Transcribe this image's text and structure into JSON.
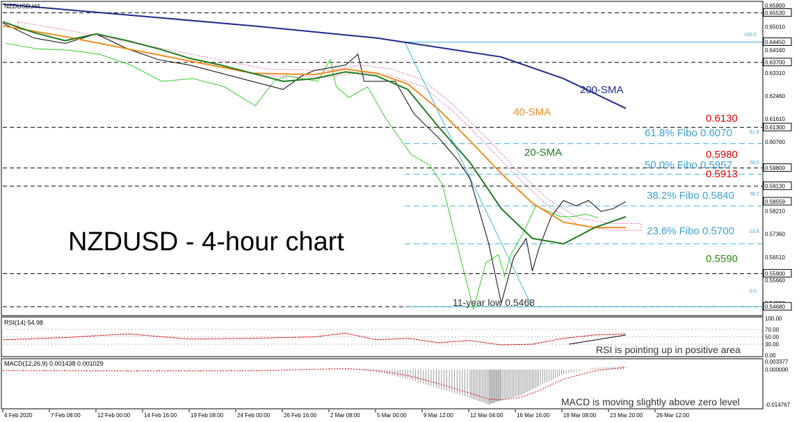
{
  "header": {
    "symbol": "NZDUSD,H4",
    "rsi_title": "RSI(14) 54.98",
    "macd_title": "MACD(12,26,9) 0.001438 0.001029"
  },
  "main_annotation": "NZDUSD - 4-hour chart",
  "chart_data": [
    {
      "type": "line",
      "title": "NZDUSD - 4-hour chart",
      "x_ticks": [
        "4 Feb 2020",
        "7 Feb 08:00",
        "12 Feb 00:00",
        "14 Feb 16:00",
        "19 Feb 08:00",
        "24 Feb 00:00",
        "26 Feb 16:00",
        "2 Mar 08:00",
        "5 Mar 00:00",
        "9 Mar 12:00",
        "12 Mar 04:00",
        "16 Mar 16:00",
        "19 Mar 08:00",
        "23 Mar 20:00",
        "26 Mar 12:00"
      ],
      "ylim": [
        0.544,
        0.659
      ],
      "y_ticks": [
        "0.65800",
        "0.65530",
        "0.65010",
        "0.64450",
        "0.64160",
        "0.63700",
        "0.63310",
        "0.62460",
        "0.61610",
        "0.61300",
        "0.60760",
        "0.59800",
        "0.59130",
        "0.58559",
        "0.58210",
        "0.57360",
        "0.56510",
        "0.55900",
        "0.55660",
        "0.54810",
        "0.54680"
      ],
      "y_ticks_boxed": [
        "0.65530",
        "0.64450",
        "0.63700",
        "0.61300",
        "0.59800",
        "0.59130",
        "0.58559",
        "0.55900",
        "0.54680"
      ],
      "horizontal_levels": [
        {
          "value": 0.6553,
          "label": "",
          "color": "#000000",
          "style": "dashed"
        },
        {
          "value": 0.637,
          "label": "",
          "color": "#000000",
          "style": "dashed"
        },
        {
          "value": 0.613,
          "label": "0.6130",
          "color": "#e00000",
          "style": "dashed"
        },
        {
          "value": 0.598,
          "label": "0.5980",
          "color": "#e00000",
          "style": "dashed"
        },
        {
          "value": 0.5913,
          "label": "0.5913",
          "color": "#e00000",
          "style": "dashed"
        },
        {
          "value": 0.559,
          "label": "0.5590",
          "color": "#2a8a10",
          "style": "dashed"
        },
        {
          "value": 0.5468,
          "label": "",
          "color": "#000000",
          "style": "dashed"
        }
      ],
      "fibonacci": [
        {
          "value": 0.6445,
          "label": "",
          "tag": "100.0"
        },
        {
          "value": 0.607,
          "label": "61.8% Fibo 0.6070",
          "tag": "61.8"
        },
        {
          "value": 0.5957,
          "label": "50.0% Fibo 0.5957",
          "tag": "50.0"
        },
        {
          "value": 0.584,
          "label": "38.2% Fibo 0.5840",
          "tag": "38.2"
        },
        {
          "value": 0.57,
          "label": "23.6% Fibo 0.5700",
          "tag": "23.6"
        },
        {
          "value": 0.5468,
          "label": "",
          "tag": "0.0"
        }
      ],
      "annotations": [
        "200-SMA",
        "40-SMA",
        "20-SMA",
        "11-year low 0.5468"
      ],
      "series": [
        {
          "name": "200-SMA",
          "color": "#1c2a8c",
          "x": [
            0,
            20,
            40,
            60,
            80,
            90,
            100
          ],
          "y": [
            0.6585,
            0.6545,
            0.6505,
            0.646,
            0.639,
            0.631,
            0.62
          ]
        },
        {
          "name": "40-SMA",
          "color": "#f08c1e",
          "x": [
            0,
            10,
            20,
            30,
            40,
            50,
            55,
            60,
            65,
            70,
            75,
            80,
            85,
            90,
            95,
            100
          ],
          "y": [
            0.6505,
            0.6465,
            0.642,
            0.6375,
            0.633,
            0.6325,
            0.6345,
            0.633,
            0.629,
            0.6195,
            0.608,
            0.596,
            0.585,
            0.578,
            0.576,
            0.576
          ]
        },
        {
          "name": "20-SMA",
          "color": "#1e7a1e",
          "x": [
            0,
            5,
            10,
            15,
            20,
            25,
            30,
            35,
            40,
            45,
            50,
            55,
            60,
            65,
            70,
            75,
            80,
            85,
            90,
            95,
            100
          ],
          "y": [
            0.652,
            0.648,
            0.645,
            0.6475,
            0.645,
            0.642,
            0.6385,
            0.636,
            0.633,
            0.63,
            0.631,
            0.6335,
            0.632,
            0.627,
            0.613,
            0.6,
            0.583,
            0.572,
            0.57,
            0.576,
            0.58
          ]
        }
      ],
      "price_path": {
        "x": [
          0,
          5,
          10,
          15,
          20,
          25,
          30,
          35,
          40,
          45,
          48,
          50,
          55,
          57,
          58,
          60,
          63,
          66,
          70,
          73,
          75,
          78,
          80,
          82,
          84,
          85,
          86,
          88,
          90,
          92,
          94,
          96,
          98,
          100
        ],
        "y": [
          0.6515,
          0.646,
          0.644,
          0.6475,
          0.642,
          0.638,
          0.636,
          0.633,
          0.63,
          0.627,
          0.632,
          0.634,
          0.636,
          0.64,
          0.63,
          0.63,
          0.63,
          0.618,
          0.609,
          0.601,
          0.594,
          0.57,
          0.548,
          0.565,
          0.572,
          0.56,
          0.568,
          0.58,
          0.586,
          0.584,
          0.586,
          0.582,
          0.583,
          0.5856
        ]
      }
    },
    {
      "type": "line",
      "title": "RSI(14) 54.98",
      "ylim": [
        0,
        100
      ],
      "y_ticks": [
        "100.00",
        "70.00",
        "50.00",
        "30.00",
        "0.00"
      ],
      "annotations": [
        "RSI is pointing up in positive area"
      ],
      "series": [
        {
          "name": "RSI(14)",
          "color": "#d00000",
          "x": [
            0,
            10,
            20,
            30,
            40,
            50,
            55,
            60,
            65,
            70,
            75,
            80,
            85,
            90,
            95,
            100
          ],
          "y": [
            42,
            48,
            58,
            44,
            46,
            50,
            60,
            42,
            46,
            34,
            40,
            28,
            30,
            46,
            55,
            58
          ]
        }
      ]
    },
    {
      "type": "bar",
      "title": "MACD(12,26,9) 0.001438 0.001029",
      "ylim": [
        -0.016,
        0.004
      ],
      "y_ticks": [
        "0.003377",
        "0.000000",
        "-0.014767"
      ],
      "annotations": [
        "MACD is moving slightly above zero level"
      ],
      "series": [
        {
          "name": "MACD",
          "color": "#9a9a9a",
          "x": [
            0,
            20,
            40,
            55,
            60,
            65,
            70,
            75,
            78,
            80,
            83,
            86,
            90,
            95,
            100
          ],
          "y": [
            -0.0005,
            -0.0008,
            -0.0006,
            0.0006,
            -0.001,
            -0.004,
            -0.008,
            -0.012,
            -0.0148,
            -0.013,
            -0.011,
            -0.007,
            -0.002,
            0.0008,
            0.0014
          ]
        },
        {
          "name": "Signal",
          "color": "#d00000",
          "x": [
            0,
            20,
            40,
            55,
            60,
            65,
            70,
            75,
            78,
            80,
            83,
            86,
            90,
            95,
            100
          ],
          "y": [
            -0.0004,
            -0.0006,
            -0.0005,
            0.0004,
            -0.0004,
            -0.0025,
            -0.006,
            -0.01,
            -0.0125,
            -0.0128,
            -0.0118,
            -0.009,
            -0.004,
            -0.0005,
            0.001
          ]
        }
      ]
    }
  ],
  "colors": {
    "fibo_line": "#3cb4dc",
    "fibo_text": "#3ca0d0",
    "resistance_text": "#e00000",
    "support_text": "#2a8a10",
    "cloud": "#e040a0",
    "green_line": "#33cc22"
  }
}
